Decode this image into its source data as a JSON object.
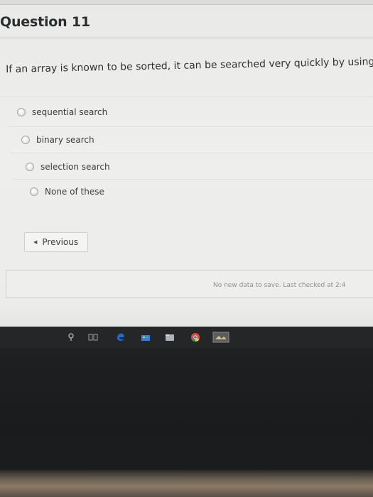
{
  "question": {
    "title": "Question 11",
    "text": "If an array is known to be sorted, it can be searched very quickly by using"
  },
  "options": [
    {
      "label": "sequential search",
      "selected": false
    },
    {
      "label": "binary search",
      "selected": false
    },
    {
      "label": "selection search",
      "selected": false
    },
    {
      "label": "None of these",
      "selected": false
    }
  ],
  "navigation": {
    "previous_label": "Previous"
  },
  "save": {
    "status": "No new data to save. Last checked at 2:4"
  },
  "taskbar": {
    "icons": [
      "search-icon",
      "task-view-icon",
      "edge-icon",
      "store-icon",
      "file-explorer-icon",
      "chrome-icon",
      "photos-icon"
    ]
  }
}
